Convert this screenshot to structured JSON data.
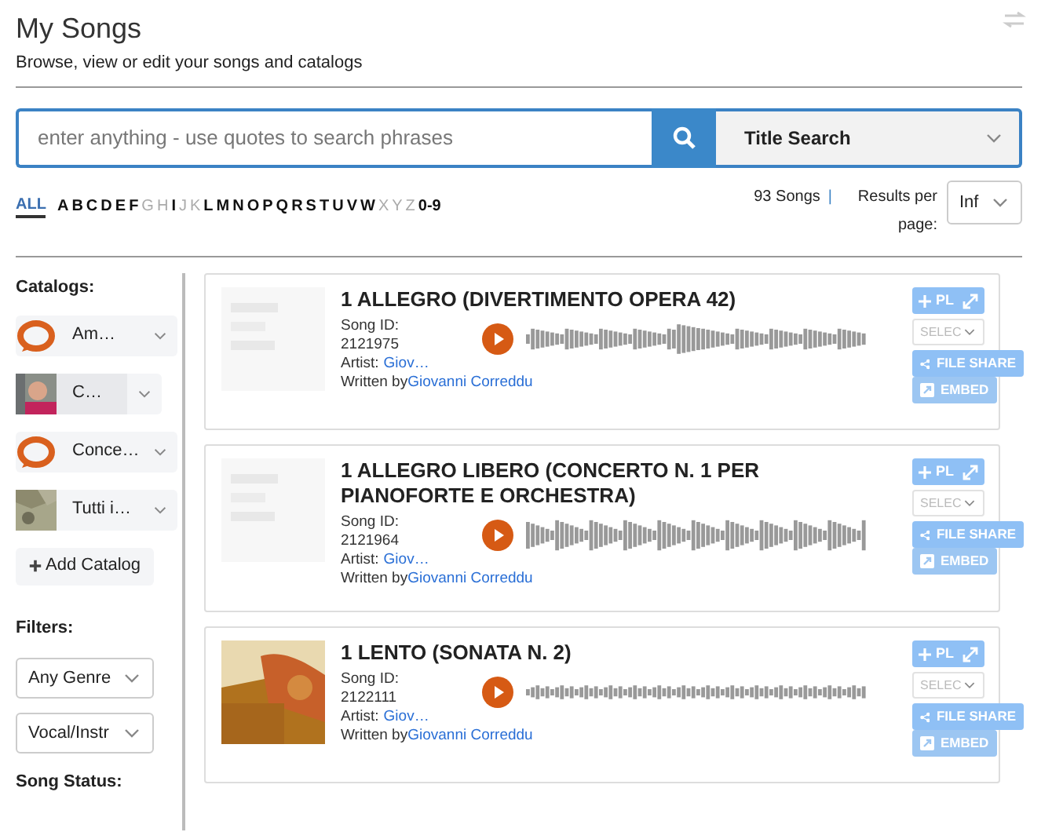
{
  "header": {
    "title": "My Songs",
    "subtitle": "Browse, view or edit your songs and catalogs"
  },
  "search": {
    "placeholder": "enter anything - use quotes to search phrases",
    "mode": "Title Search"
  },
  "alphabet": [
    {
      "label": "ALL",
      "selected": true,
      "disabled": false
    },
    {
      "label": "A",
      "selected": false,
      "disabled": false
    },
    {
      "label": "B",
      "selected": false,
      "disabled": false
    },
    {
      "label": "C",
      "selected": false,
      "disabled": false
    },
    {
      "label": "D",
      "selected": false,
      "disabled": false
    },
    {
      "label": "E",
      "selected": false,
      "disabled": false
    },
    {
      "label": "F",
      "selected": false,
      "disabled": false
    },
    {
      "label": "G",
      "selected": false,
      "disabled": true
    },
    {
      "label": "H",
      "selected": false,
      "disabled": true
    },
    {
      "label": "I",
      "selected": false,
      "disabled": false
    },
    {
      "label": "J",
      "selected": false,
      "disabled": true
    },
    {
      "label": "K",
      "selected": false,
      "disabled": true
    },
    {
      "label": "L",
      "selected": false,
      "disabled": false
    },
    {
      "label": "M",
      "selected": false,
      "disabled": false
    },
    {
      "label": "N",
      "selected": false,
      "disabled": false
    },
    {
      "label": "O",
      "selected": false,
      "disabled": false
    },
    {
      "label": "P",
      "selected": false,
      "disabled": false
    },
    {
      "label": "Q",
      "selected": false,
      "disabled": false
    },
    {
      "label": "R",
      "selected": false,
      "disabled": false
    },
    {
      "label": "S",
      "selected": false,
      "disabled": false
    },
    {
      "label": "T",
      "selected": false,
      "disabled": false
    },
    {
      "label": "U",
      "selected": false,
      "disabled": false
    },
    {
      "label": "V",
      "selected": false,
      "disabled": false
    },
    {
      "label": "W",
      "selected": false,
      "disabled": false
    },
    {
      "label": "X",
      "selected": false,
      "disabled": true
    },
    {
      "label": "Y",
      "selected": false,
      "disabled": true
    },
    {
      "label": "Z",
      "selected": false,
      "disabled": true
    },
    {
      "label": "0-9",
      "selected": false,
      "disabled": false
    }
  ],
  "results": {
    "count": "93 Songs",
    "separator": "|",
    "per_page_label": "Results per page:",
    "per_page": "Inf"
  },
  "sidebar": {
    "catalogs_heading": "Catalogs:",
    "catalogs": [
      {
        "name": "Am…",
        "kind": "logo",
        "selected": false
      },
      {
        "name": "C…",
        "kind": "picture",
        "selected": true
      },
      {
        "name": "Conce…",
        "kind": "logo",
        "selected": false
      },
      {
        "name": "Tutti i…",
        "kind": "picture",
        "selected": false
      }
    ],
    "add_catalog": "Add Catalog",
    "filters_heading": "Filters:",
    "filters": [
      "Any Genre",
      "Vocal/Instr"
    ],
    "status_heading": "Song Status:"
  },
  "songs": [
    {
      "title": "1 ALLEGRO (DIVERTIMENTO OPERA 42)",
      "id_label": "Song ID:",
      "id": "2121975",
      "artist_label": "Artist:",
      "artist": "Giov…",
      "writer_label": "Written by",
      "writer": "Giovanni Correddu",
      "pl": "PL",
      "select": "SELEC",
      "share": "FILE SHARE",
      "embed": "EMBED"
    },
    {
      "title": "1 ALLEGRO LIBERO (CONCERTO N. 1 PER PIANOFORTE E ORCHESTRA)",
      "id_label": "Song ID:",
      "id": "2121964",
      "artist_label": "Artist:",
      "artist": "Giov…",
      "writer_label": "Written by",
      "writer": "Giovanni Correddu",
      "pl": "PL",
      "select": "SELEC",
      "share": "FILE SHARE",
      "embed": "EMBED"
    },
    {
      "title": "1 LENTO (SONATA N. 2)",
      "id_label": "Song ID:",
      "id": "2122111",
      "artist_label": "Artist:",
      "artist": "Giov…",
      "writer_label": "Written by",
      "writer": "Giovanni Correddu",
      "pl": "PL",
      "select": "SELEC",
      "share": "FILE SHARE",
      "embed": "EMBED"
    }
  ]
}
